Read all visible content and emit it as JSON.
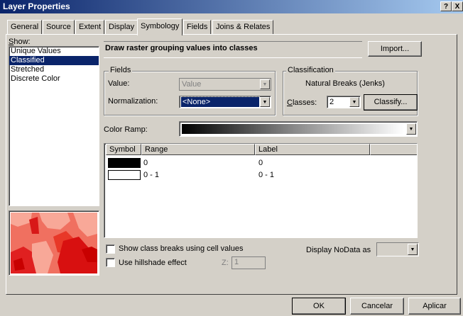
{
  "window": {
    "title": "Layer Properties",
    "help_label": "?",
    "close_label": "X"
  },
  "tabs": [
    {
      "label": "General"
    },
    {
      "label": "Source"
    },
    {
      "label": "Extent"
    },
    {
      "label": "Display"
    },
    {
      "label": "Symbology"
    },
    {
      "label": "Fields"
    },
    {
      "label": "Joins & Relates"
    }
  ],
  "active_tab": "Symbology",
  "show": {
    "label": "Show:",
    "items": [
      "Unique Values",
      "Classified",
      "Stretched",
      "Discrete Color"
    ],
    "selected": "Classified"
  },
  "description": "Draw raster grouping values into classes",
  "import_label": "Import...",
  "fields": {
    "group_label": "Fields",
    "value_label": "Value:",
    "value_value": "Value",
    "normalization_label": "Normalization:",
    "normalization_value": "<None>"
  },
  "classification": {
    "group_label": "Classification",
    "method": "Natural Breaks (Jenks)",
    "classes_label": "Classes:",
    "classes_value": "2",
    "classify_label": "Classify..."
  },
  "color_ramp": {
    "label": "Color Ramp:"
  },
  "table": {
    "headers": [
      "Symbol",
      "Range",
      "Label"
    ],
    "rows": [
      {
        "symbol_color": "#000000",
        "range": "0",
        "label": "0"
      },
      {
        "symbol_color": "#ffffff",
        "range": "0 - 1",
        "label": "0 - 1"
      }
    ]
  },
  "options": {
    "show_breaks_label": "Show class breaks using cell values",
    "hillshade_label": "Use hillshade effect",
    "z_label": "Z:",
    "z_value": "1",
    "nodata_label": "Display NoData as"
  },
  "buttons": {
    "ok": "OK",
    "cancel": "Cancelar",
    "apply": "Aplicar"
  },
  "colors": {
    "title_gradient_start": "#0a246a",
    "selection": "#0a246a",
    "dialog_face": "#d4d0c8"
  }
}
